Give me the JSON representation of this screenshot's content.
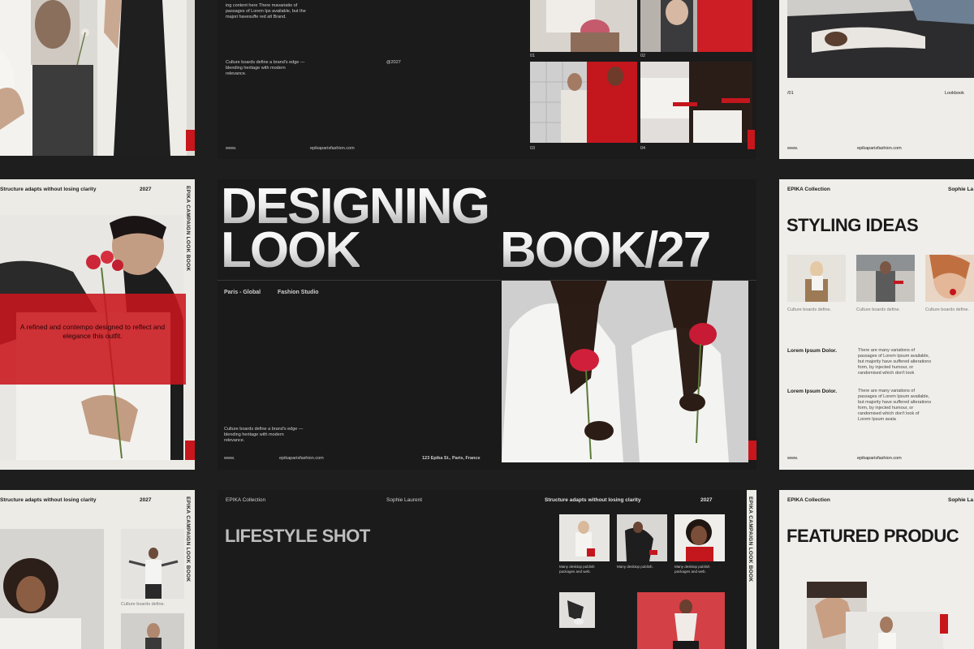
{
  "hero": {
    "title_line1": "DESIGNING",
    "title_line2": "LOOK",
    "title_line3": "BOOK/27",
    "location": "Paris - Global",
    "studio": "Fashion Studio",
    "desc": "Culture boards define a brand's edge  —  blending heritage with modern relevance.",
    "www": "www.",
    "site": "epikaparisfashion.com",
    "address": "123 Epika St.,  Paris, France"
  },
  "top_mid": {
    "snippet": "ing content here There mavariatio of passages of Lorem Ips available, but the majori havesuffe red alt Brand.",
    "desc": "Culture boards define a brand's edge  —  blending heritage with modern relevance.",
    "year": "@2027",
    "www": "www.",
    "site": "epikaparisfashion.com"
  },
  "top_grid": {
    "n1": "01",
    "n2": "02",
    "n3": "03",
    "n4": "04"
  },
  "top_right": {
    "num": "/01",
    "label": "Lookbook",
    "www": "www.",
    "site": "epikaparisfashion.com"
  },
  "mid_left": {
    "header": "Structure adapts without losing clarity",
    "year": "2027",
    "vertical": "EPIKA CAMPAIGN LOOK BOOK",
    "overlay": "A refined and contempo designed to reflect and elegance this outfit."
  },
  "styling": {
    "brand": "EPIKA Collection",
    "author": "Sophie La",
    "title": "STYLING IDEAS",
    "cap1": "Culture boards define.",
    "cap2": "Culture boards define.",
    "cap3": "Culture boards define.",
    "row1_label": "Lorem Ipsum Dolor.",
    "row1_text": "There are many variations of passages of Lorem Ipsum available, but majority have suffered alterations form, by injected humour, or randomised which don't look",
    "row2_label": "Lorem Ipsum Dolor.",
    "row2_text": "There are many variations of passages of Lorem Ipsum available, but majority have suffered alterations form, by injected humour, or randomised which don't look of Lorem Ipsum avala",
    "www": "www.",
    "site": "epikaparisfashion.com"
  },
  "bottom_left": {
    "header": "Structure adapts without losing clarity",
    "year": "2027",
    "vertical": "EPIKA CAMPAIGN LOOK BOOK",
    "caption": "Culture boards define."
  },
  "lifestyle": {
    "brand": "EPIKA Collection",
    "author": "Sophie Laurent",
    "title": "LIFESTYLE SHOT",
    "header": "Structure adapts without losing clarity",
    "year": "2027",
    "vertical": "EPIKA CAMPAIGN LOOK BOOK",
    "cap1": "Many desktop publish packages and web.",
    "cap2": "Many desktop publish.",
    "cap3": "Many desktop publish packages and web."
  },
  "featured": {
    "brand": "EPIKA Collection",
    "author": "Sophie La",
    "title": "FEATURED PRODUC"
  },
  "colors": {
    "accent": "#c8161d",
    "dark": "#1b1b1c",
    "light": "#ebeae5"
  }
}
